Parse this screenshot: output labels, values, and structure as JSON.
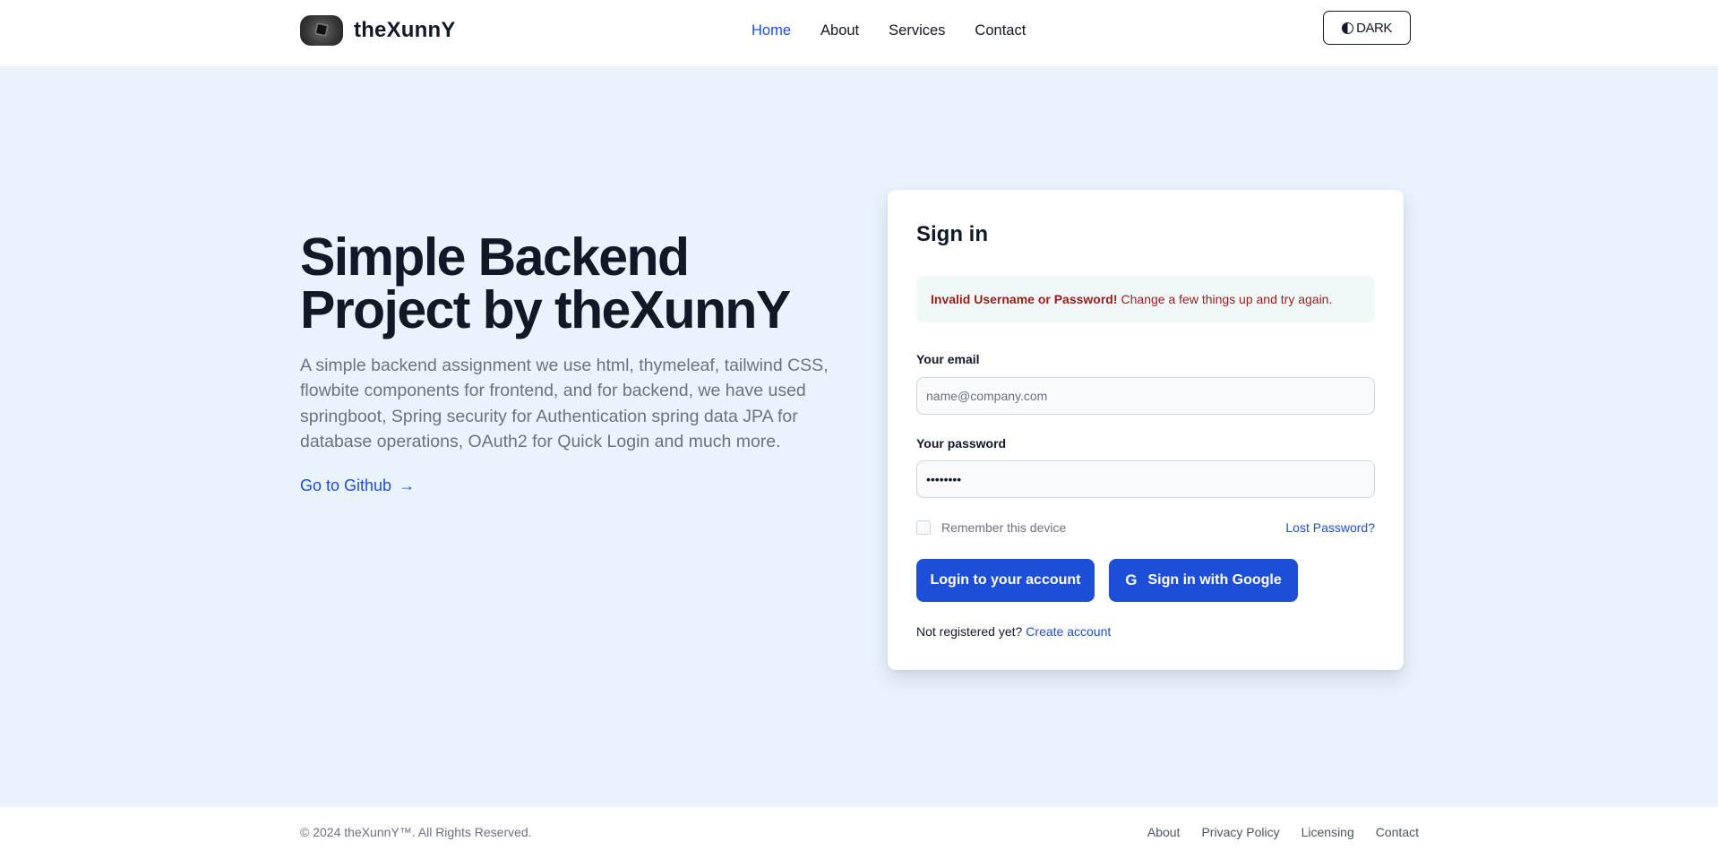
{
  "brand": {
    "name": "theXunnY"
  },
  "nav": {
    "items": [
      {
        "label": "Home",
        "active": true
      },
      {
        "label": "About",
        "active": false
      },
      {
        "label": "Services",
        "active": false
      },
      {
        "label": "Contact",
        "active": false
      }
    ],
    "theme_toggle_label": "DARK"
  },
  "hero": {
    "title_line1": "Simple Backend",
    "title_line2": "Project by theXunnY",
    "description": "A simple backend assignment we use html, thymeleaf, tailwind CSS, flowbite components for frontend, and for backend, we have used springboot, Spring security for Authentication spring data JPA for database operations, OAuth2 for Quick Login and much more.",
    "github_link": "Go to Github",
    "github_arrow": "→"
  },
  "signin": {
    "title": "Sign in",
    "alert_bold": "Invalid Username or Password!",
    "alert_text": "Change a few things up and try again.",
    "email_label": "Your email",
    "email_placeholder": "name@company.com",
    "email_value": "",
    "password_label": "Your password",
    "password_value": "••••••••",
    "remember_label": "Remember this device",
    "lost_password": "Lost Password?",
    "login_button": "Login to your account",
    "google_button": "Sign in with Google",
    "google_icon_glyph": "G",
    "not_registered": "Not registered yet?",
    "create_account": "Create account"
  },
  "footer": {
    "copyright": "© 2024 theXunnY™. All Rights Reserved.",
    "links": [
      "About",
      "Privacy Policy",
      "Licensing",
      "Contact"
    ]
  },
  "colors": {
    "accent": "#1d4ed8",
    "hero_background": "#e9f3fd",
    "error_text": "#991b1b"
  }
}
